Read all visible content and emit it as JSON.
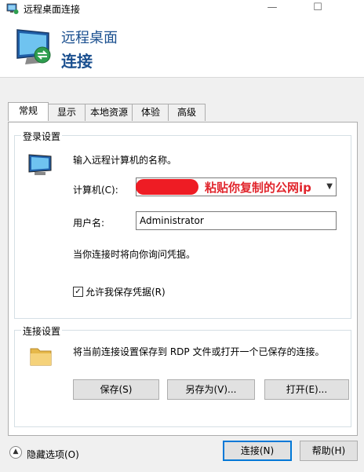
{
  "window": {
    "title": "远程桌面连接",
    "minimize": "—",
    "maximize": "☐"
  },
  "banner": {
    "line1": "远程桌面",
    "line2": "连接"
  },
  "tabs": [
    {
      "label": "常规",
      "active": true
    },
    {
      "label": "显示",
      "active": false
    },
    {
      "label": "本地资源",
      "active": false
    },
    {
      "label": "体验",
      "active": false
    },
    {
      "label": "高级",
      "active": false
    }
  ],
  "login": {
    "group_title": "登录设置",
    "prompt": "输入远程计算机的名称。",
    "computer_label": "计算机(C):",
    "computer_annotation": "粘贴你复制的公网ip",
    "username_label": "用户名:",
    "username_value": "Administrator",
    "credential_note": "当你连接时将向你询问凭据。",
    "save_creds_label": "允许我保存凭据(R)",
    "save_creds_checked": true
  },
  "connection": {
    "group_title": "连接设置",
    "description": "将当前连接设置保存到 RDP 文件或打开一个已保存的连接。",
    "save_label": "保存(S)",
    "saveas_label": "另存为(V)...",
    "open_label": "打开(E)..."
  },
  "footer": {
    "hide_options_label": "隐藏选项(O)",
    "connect_label": "连接(N)",
    "help_label": "帮助(H)"
  },
  "colors": {
    "banner_text": "#1a4f8f",
    "annotation": "#e1262d",
    "redaction": "#ee1c24"
  }
}
